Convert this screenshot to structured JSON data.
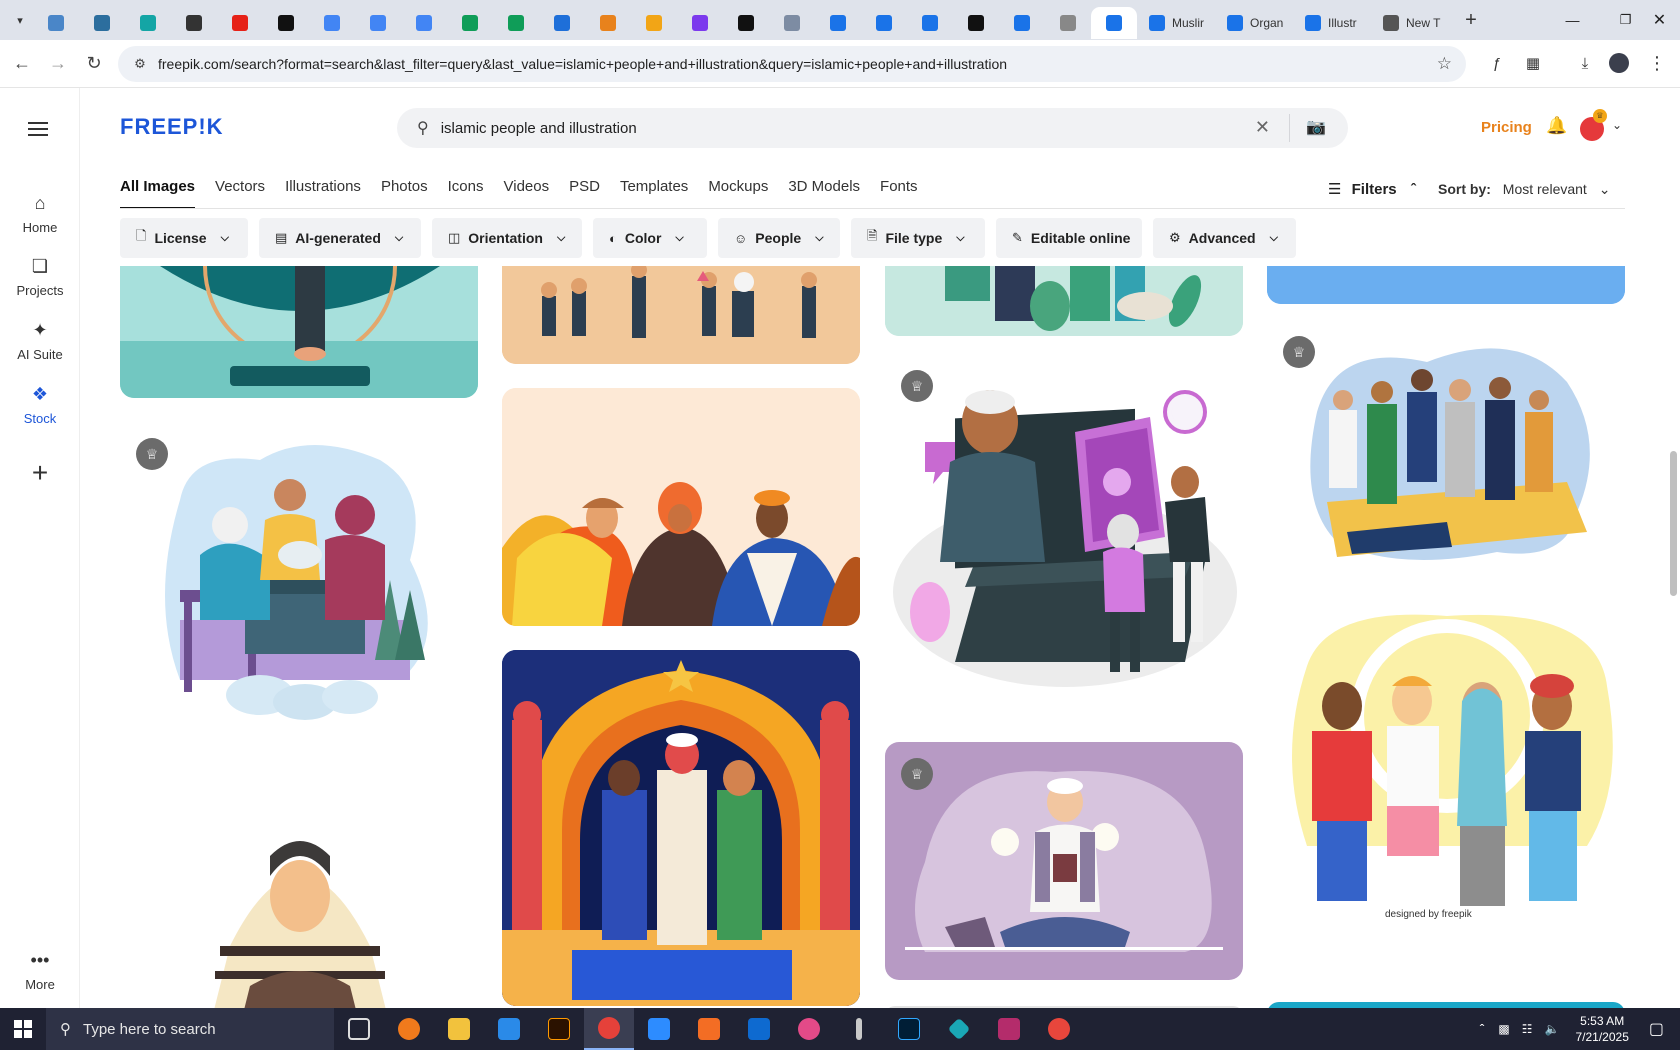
{
  "browser": {
    "tabs": [
      {
        "icon": "chrome-menu-icon"
      },
      {
        "color": "#4a86c8"
      },
      {
        "color": "#2c6e9e"
      },
      {
        "color": "#14a5a5"
      },
      {
        "color": "#333333"
      },
      {
        "color": "#e62117"
      },
      {
        "color": "#111111"
      },
      {
        "color": "#4285f4"
      },
      {
        "color": "#4285f4"
      },
      {
        "color": "#4285f4"
      },
      {
        "color": "#0f9d58"
      },
      {
        "color": "#0f9d58"
      },
      {
        "color": "#1e6fd9"
      },
      {
        "color": "#e8821c"
      },
      {
        "color": "#f2a516"
      },
      {
        "color": "#7c3aed"
      },
      {
        "color": "#111111"
      },
      {
        "color": "#7d8ca3"
      },
      {
        "color": "#1a73e8"
      },
      {
        "color": "#1a73e8"
      },
      {
        "color": "#1a73e8"
      },
      {
        "color": "#111111"
      },
      {
        "color": "#1a73e8"
      },
      {
        "color": "#888888"
      }
    ],
    "named_tabs": [
      {
        "title": "Muslir"
      },
      {
        "title": "Organ"
      },
      {
        "title": "Illustr"
      },
      {
        "title": "New T"
      }
    ],
    "new_tab_label": "+",
    "url": "freepik.com/search?format=search&last_filter=query&last_value=islamic+people+and+illustration&query=islamic+people+and+illustration"
  },
  "site": {
    "logo": "FREEP!K",
    "search_query": "islamic people and illustration",
    "pricing": "Pricing",
    "rail": [
      {
        "label": "Home",
        "icon": "home-icon"
      },
      {
        "label": "Projects",
        "icon": "projects-icon"
      },
      {
        "label": "AI Suite",
        "icon": "ai-suite-icon"
      },
      {
        "label": "Stock",
        "icon": "stock-icon"
      },
      {
        "label": "More",
        "icon": "more-icon"
      }
    ],
    "category_tabs": [
      "All Images",
      "Vectors",
      "Illustrations",
      "Photos",
      "Icons",
      "Videos",
      "PSD",
      "Templates",
      "Mockups",
      "3D Models",
      "Fonts"
    ],
    "filters_label": "Filters",
    "sort_label": "Sort by:",
    "sort_value": "Most relevant",
    "chips": [
      "License",
      "AI-generated",
      "Orientation",
      "Color",
      "People",
      "File type",
      "Editable online",
      "Advanced"
    ],
    "card_credit": "designed by  freepik"
  },
  "taskbar": {
    "search_placeholder": "Type here to search",
    "time": "5:53 AM",
    "date": "7/21/2025"
  }
}
